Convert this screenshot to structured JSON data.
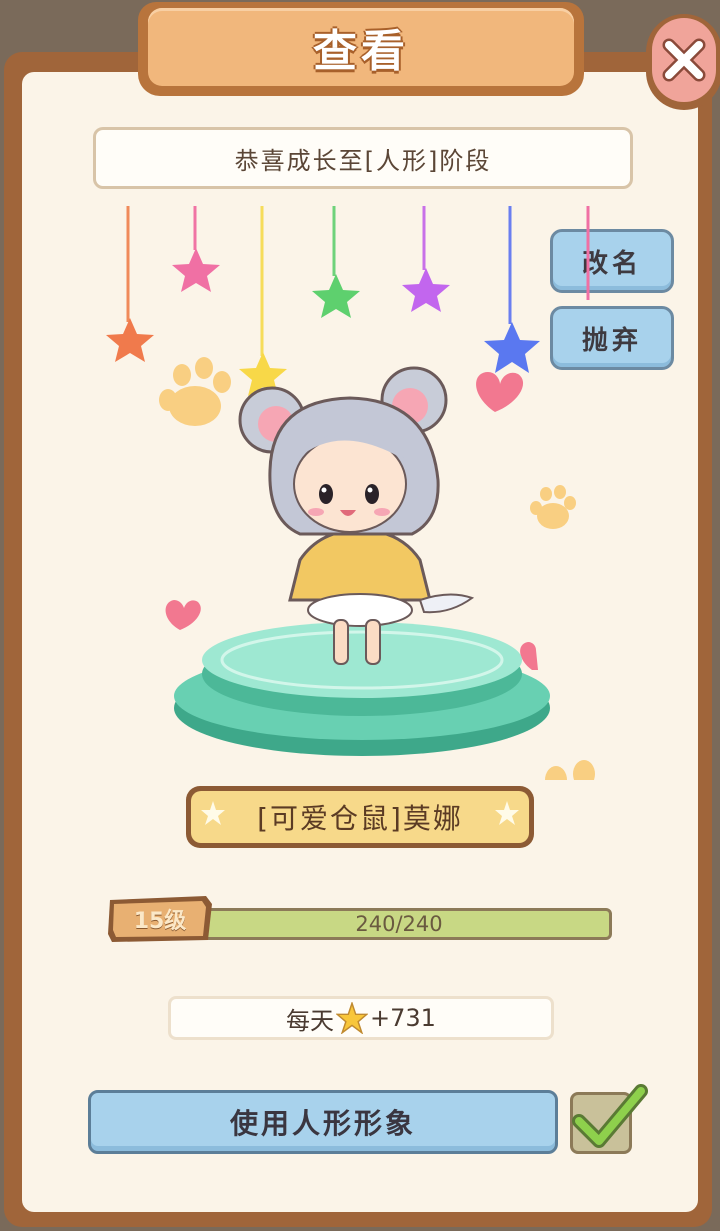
{
  "header": {
    "title": "查看"
  },
  "banner": {
    "text": "恭喜成长至[人形]阶段"
  },
  "actions": {
    "rename": "改名",
    "abandon": "抛弃"
  },
  "pet": {
    "name": "[可爱仓鼠]莫娜"
  },
  "level": {
    "label": "15级",
    "progress_text": "240/240",
    "progress_fraction": 1.0
  },
  "daily": {
    "prefix": "每天",
    "icon": "star-icon",
    "value": "+731"
  },
  "footer": {
    "use_button": "使用人形形象",
    "checkbox_checked": true
  },
  "colors": {
    "frame": "#a0653a",
    "panel": "#fbf4e8",
    "title_tab": "#f1b77c",
    "blue_button": "#a8d2ec",
    "progress_fill": "#c8d884",
    "close_button": "#f0a49a"
  }
}
